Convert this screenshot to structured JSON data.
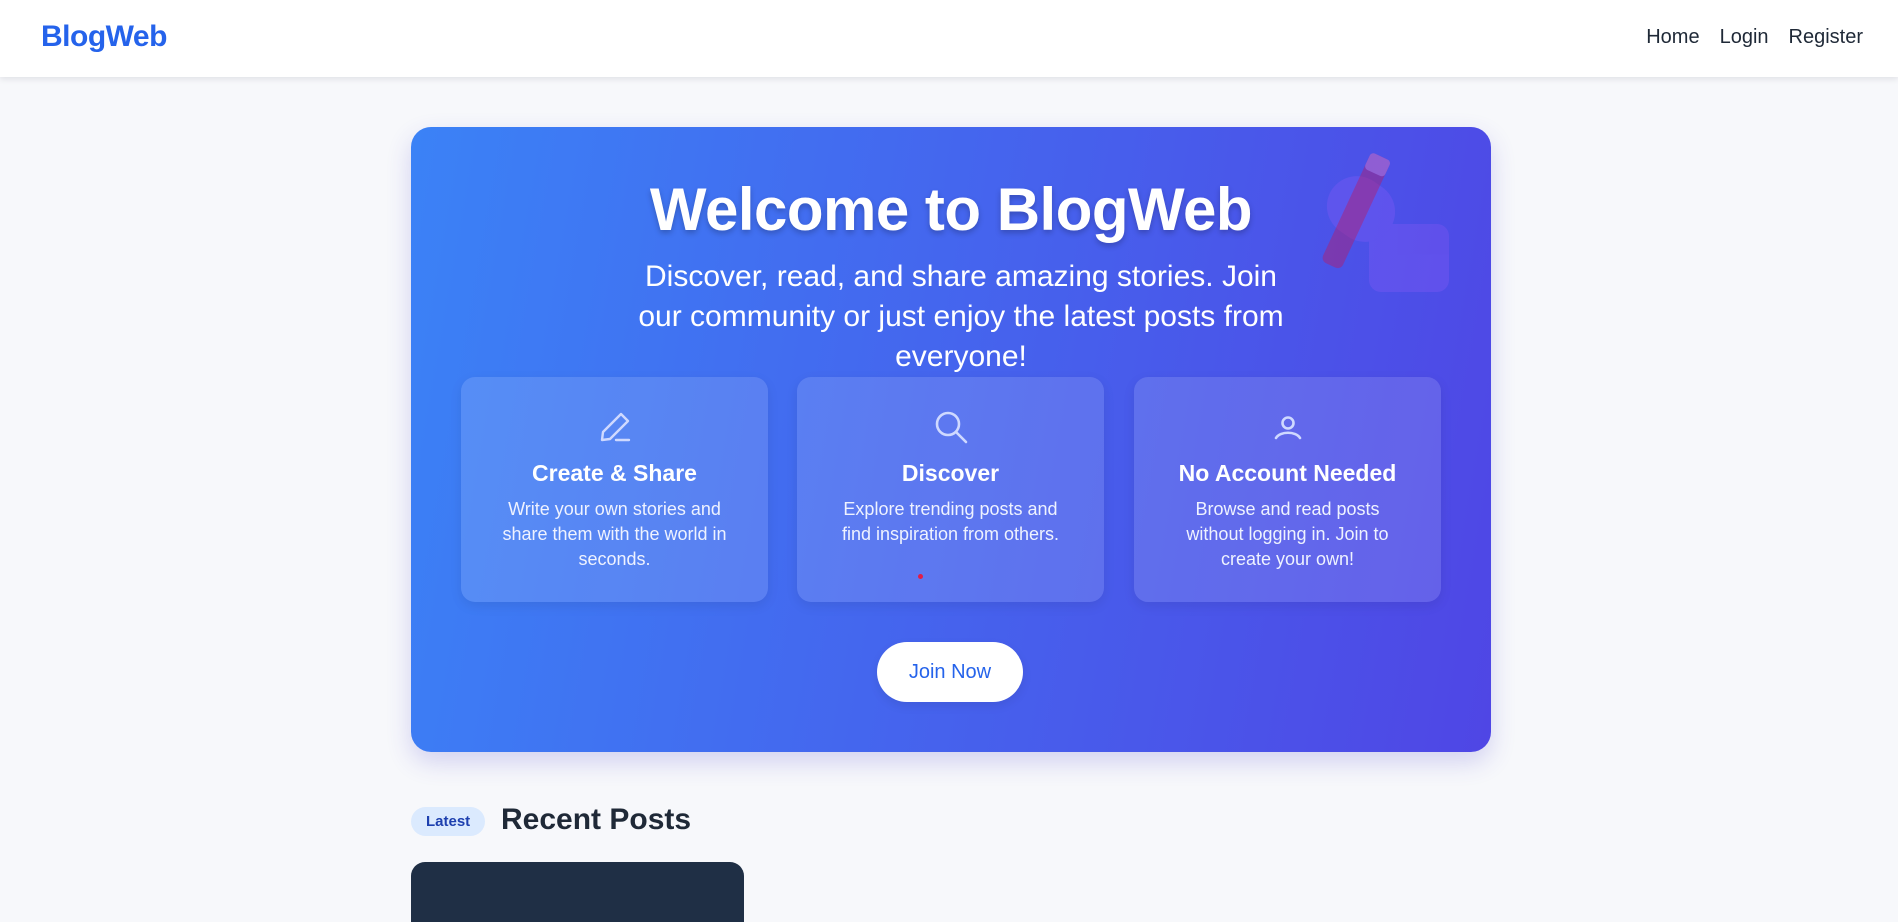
{
  "nav": {
    "brand": "BlogWeb",
    "links": [
      "Home",
      "Login",
      "Register"
    ]
  },
  "hero": {
    "title": "Welcome to BlogWeb",
    "subtitle": "Discover, read, and share amazing stories. Join our community or just enjoy the latest posts from everyone!",
    "features": [
      {
        "icon": "pencil-icon",
        "title": "Create & Share",
        "description": "Write your own stories and share them with the world in seconds."
      },
      {
        "icon": "search-icon",
        "title": "Discover",
        "description": "Explore trending posts and find inspiration from others."
      },
      {
        "icon": "user-icon",
        "title": "No Account Needed",
        "description": "Browse and read posts without logging in. Join to create your own!"
      }
    ],
    "cta_label": "Join Now",
    "decoration_icon": "hand-writing-icon"
  },
  "recent": {
    "badge": "Latest",
    "title": "Recent Posts"
  },
  "colors": {
    "brand": "#2563eb",
    "hero_gradient_start": "#3b82f6",
    "hero_gradient_end": "#4f46e5",
    "badge_bg": "#dbeafe",
    "post_card_bg": "#1f2f45"
  }
}
